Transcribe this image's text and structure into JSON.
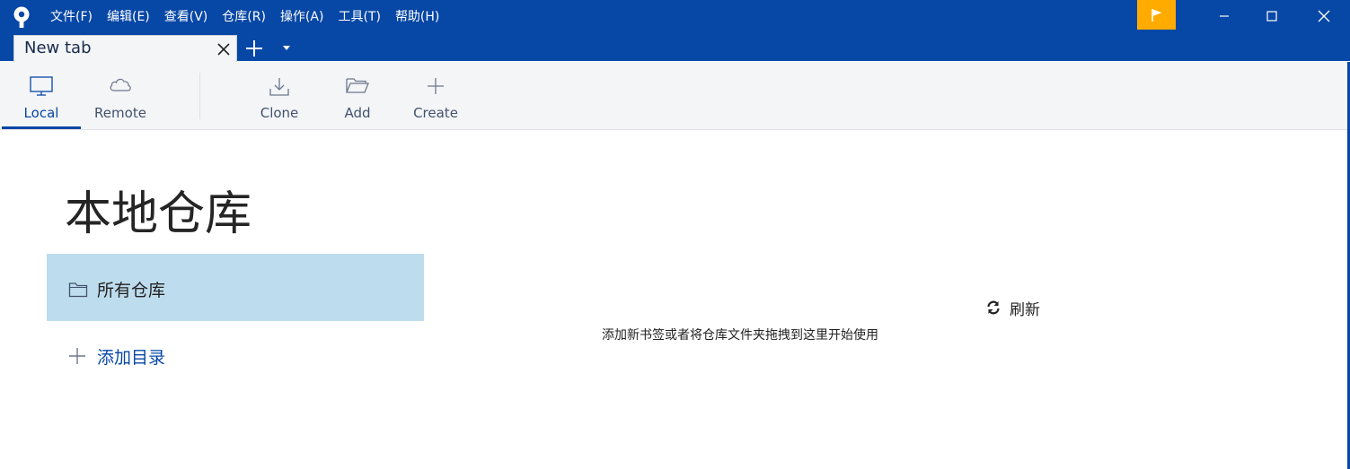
{
  "menu": [
    "文件(F)",
    "编辑(E)",
    "查看(V)",
    "仓库(R)",
    "操作(A)",
    "工具(T)",
    "帮助(H)"
  ],
  "tab": {
    "title": "New tab"
  },
  "toolbar": {
    "local": "Local",
    "remote": "Remote",
    "clone": "Clone",
    "add": "Add",
    "create": "Create"
  },
  "main": {
    "title": "本地仓库",
    "all_repos": "所有仓库",
    "add_directory": "添加目录",
    "refresh": "刷新",
    "empty_hint": "添加新书签或者将仓库文件夹拖拽到这里开始使用"
  },
  "colors": {
    "titlebar": "#0747a6",
    "flag": "#ffab00",
    "selected_nav": "#bddced",
    "link": "#0747a6"
  },
  "icons": {
    "logo": "sourcetree-logo-icon",
    "flag": "flag-icon",
    "local": "monitor-icon",
    "remote": "cloud-icon",
    "clone": "download-icon",
    "add": "folder-open-icon",
    "create": "plus-icon",
    "folder": "folder-icon",
    "refresh": "refresh-icon"
  }
}
